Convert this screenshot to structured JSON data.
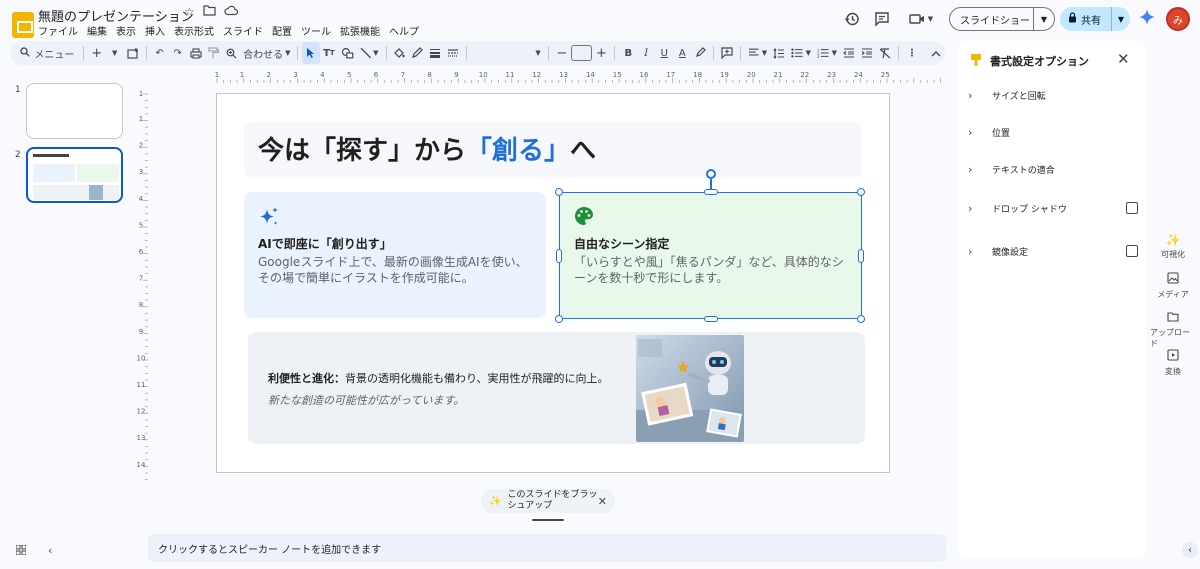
{
  "doc": {
    "title": "無題のプレゼンテーション",
    "menu": [
      "ファイル",
      "編集",
      "表示",
      "挿入",
      "表示形式",
      "スライド",
      "配置",
      "ツール",
      "拡張機能",
      "ヘルプ"
    ]
  },
  "header": {
    "slideshow_label": "スライドショー",
    "share_label": "共有",
    "avatar_initial": "み"
  },
  "toolbar": {
    "menu_label": "メニュー",
    "zoom_label": "合わせる"
  },
  "filmstrip": {
    "slides": [
      {
        "number": "1",
        "selected": false
      },
      {
        "number": "2",
        "selected": true
      }
    ]
  },
  "ruler": {
    "h_ticks": [
      "1",
      "1",
      "2",
      "3",
      "4",
      "5",
      "6",
      "7",
      "8",
      "9",
      "10",
      "11",
      "12",
      "13",
      "14",
      "15",
      "16",
      "17",
      "18",
      "19",
      "20",
      "21",
      "22",
      "23",
      "24",
      "25"
    ],
    "v_ticks": [
      "1",
      "1",
      "2",
      "3",
      "4",
      "5",
      "6",
      "7",
      "8",
      "9",
      "10",
      "11",
      "12",
      "13",
      "14"
    ]
  },
  "slide": {
    "title_plain": "今は「探す」から",
    "title_accent": "「創る」",
    "title_end": "へ",
    "card1": {
      "heading": "AIで即座に「創り出す」",
      "body": "Googleスライド上で、最新の画像生成AIを使い、その場で簡単にイラストを作成可能に。"
    },
    "card2": {
      "heading": "自由なシーン指定",
      "body": "「いらすとや風」「焦るパンダ」など、具体的なシーンを数十秒で形にします。"
    },
    "bottom": {
      "bold": "利便性と進化：",
      "text": "背景の透明化機能も備わり、実用性が飛躍的に向上。",
      "italic": "新たな創造の可能性が広がっています。"
    }
  },
  "chip": {
    "label": "このスライドをブラッシュアップ"
  },
  "notes": {
    "placeholder": "クリックするとスピーカー ノートを追加できます"
  },
  "panel": {
    "title": "書式設定オプション",
    "options": [
      {
        "label": "サイズと回転",
        "has_checkbox": false
      },
      {
        "label": "位置",
        "has_checkbox": false
      },
      {
        "label": "テキストの適合",
        "has_checkbox": false
      },
      {
        "label": "ドロップ シャドウ",
        "has_checkbox": true
      },
      {
        "label": "鏡像設定",
        "has_checkbox": true
      }
    ]
  },
  "rail": {
    "items": [
      {
        "label": "可視化",
        "icon": "sparkle-icon"
      },
      {
        "label": "メディア",
        "icon": "media-icon"
      },
      {
        "label": "アップロード",
        "icon": "folder-icon"
      },
      {
        "label": "変換",
        "icon": "convert-icon"
      }
    ]
  },
  "colors": {
    "accent_blue": "#1f6fd8",
    "selection_blue": "#1a73e8",
    "card_blue_bg": "#eaf2fd",
    "card_green_bg": "#e8f9ec",
    "palette_green": "#1e8e3e",
    "logo_yellow": "#f4b400"
  }
}
